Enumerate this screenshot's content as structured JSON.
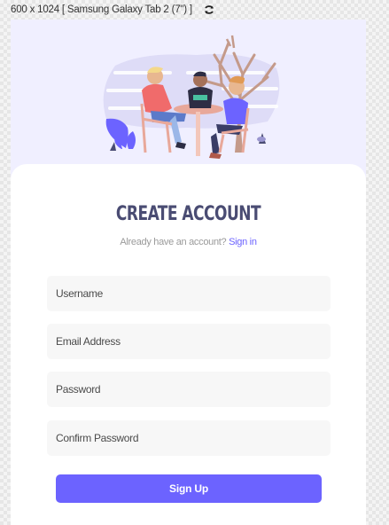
{
  "device_bar": {
    "label": "600 x 1024 [ Samsung Galaxy Tab 2 (7\") ]",
    "rotate_icon": "rotate-icon"
  },
  "form": {
    "title": "CREATE ACCOUNT",
    "subtitle_text": "Already have an account?",
    "signin_link": "Sign in",
    "fields": {
      "username_placeholder": "Username",
      "email_placeholder": "Email Address",
      "password_placeholder": "Password",
      "confirm_placeholder": "Confirm Password"
    },
    "submit_label": "Sign Up"
  },
  "colors": {
    "accent": "#6c63ff",
    "title": "#4a4c73",
    "hero_background": "#f0efff"
  }
}
